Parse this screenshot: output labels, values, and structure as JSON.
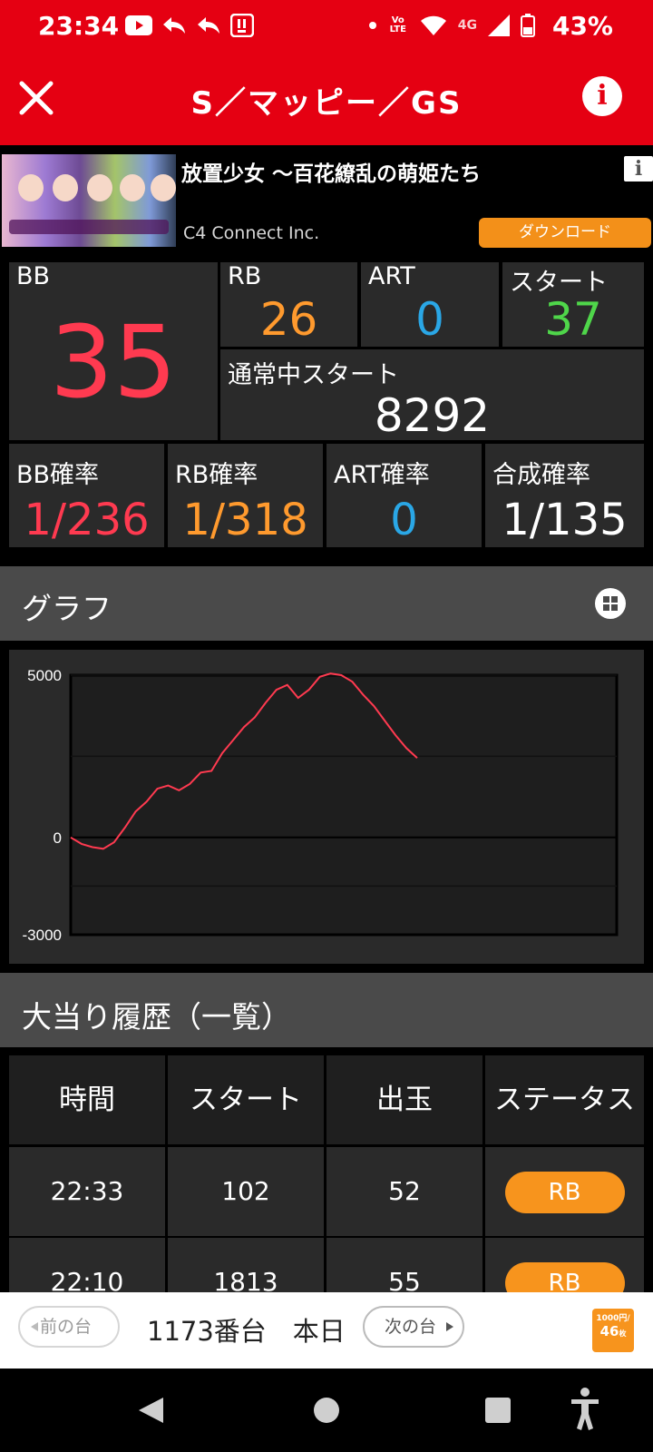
{
  "status_bar": {
    "time": "23:34",
    "battery": "43%",
    "volte_line1": "Vo",
    "volte_line2": "LTE",
    "network": "4G"
  },
  "header": {
    "title": "S／マッピー／GS"
  },
  "ad": {
    "title": "放置少女 〜百花繚乱の萌姫たち",
    "company": "C4 Connect Inc.",
    "button": "ダウンロード",
    "info": "i"
  },
  "stats": {
    "bb_label": "BB",
    "bb_value": "35",
    "rb_label": "RB",
    "rb_value": "26",
    "art_label": "ART",
    "art_value": "0",
    "start_label": "スタート",
    "start_value": "37",
    "normal_start_label": "通常中スタート",
    "normal_start_value": "8292",
    "bb_prob_label": "BB確率",
    "bb_prob_value": "1/236",
    "rb_prob_label": "RB確率",
    "rb_prob_value": "1/318",
    "art_prob_label": "ART確率",
    "art_prob_value": "0",
    "total_prob_label": "合成確率",
    "total_prob_value": "1/135"
  },
  "colors": {
    "brand_red": "#e50012",
    "bb": "#ff3a50",
    "rb": "#ff9a2e",
    "art": "#2aa7e6",
    "start": "#4fd64a",
    "badge": "#f7941d"
  },
  "graph_section": {
    "title": "グラフ"
  },
  "chart_data": {
    "type": "line",
    "title": "",
    "xlabel": "",
    "ylabel": "",
    "yticks": [
      "5000",
      "0",
      "-3000"
    ],
    "ylim": [
      -3000,
      5000
    ],
    "grid": true,
    "series": [
      {
        "values": [
          0,
          -200,
          -300,
          -350,
          -150,
          300,
          800,
          1100,
          1500,
          1600,
          1450,
          1650,
          2000,
          2050,
          2600,
          3000,
          3400,
          3700,
          4150,
          4550,
          4700,
          4300,
          4550,
          4950,
          5050,
          5000,
          4800,
          4400,
          4050,
          3600,
          3150,
          2750,
          2450
        ]
      }
    ]
  },
  "history_section": {
    "title": "大当り履歴（一覧）"
  },
  "history_table": {
    "headers": [
      "時間",
      "スタート",
      "出玉",
      "ステータス"
    ],
    "rows": [
      {
        "time": "22:33",
        "start": "102",
        "payout": "52",
        "status": "RB"
      },
      {
        "time": "22:10",
        "start": "1813",
        "payout": "55",
        "status": "RB"
      }
    ]
  },
  "bottom_nav": {
    "prev": "前の台",
    "machine": "1173番台　本日",
    "next": "次の台",
    "price_line1": "1000円/",
    "price_line2": "46",
    "price_unit": "枚"
  }
}
